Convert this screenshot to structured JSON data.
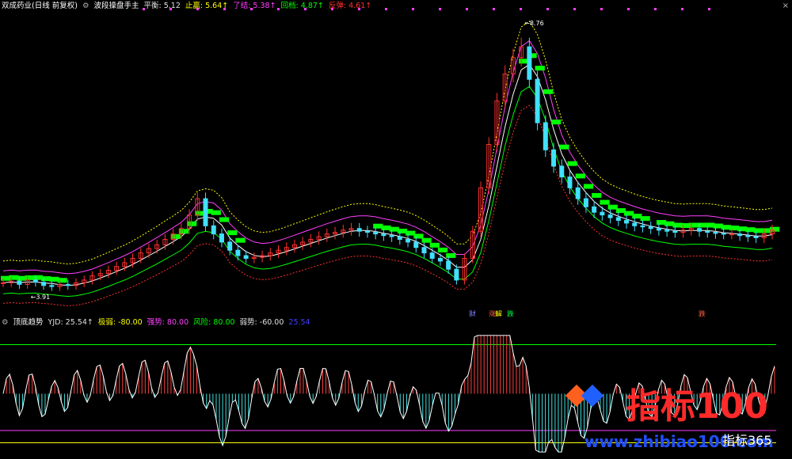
{
  "main_header": {
    "stock": "双成药业(日线 前复权)",
    "indicator": "波段操盘手主",
    "items": [
      {
        "label": "平衡:",
        "value": "5.12",
        "color": "#e0e0e0",
        "arrow": ""
      },
      {
        "label": "止赢:",
        "value": "5.64",
        "color": "#ffff00",
        "arrow": "↑"
      },
      {
        "label": "了结:",
        "value": "5.38",
        "color": "#ff40ff",
        "arrow": "↑"
      },
      {
        "label": "回档:",
        "value": "4.87",
        "color": "#00ff00",
        "arrow": "↑"
      },
      {
        "label": "反弹:",
        "value": "4.61",
        "color": "#ff3030",
        "arrow": "↑"
      }
    ]
  },
  "close_symbol": "×",
  "price_annotations": {
    "high": "8.76",
    "low": "3.91"
  },
  "signals": [
    {
      "text": "财",
      "color": "#8080ff"
    },
    {
      "text": "涨",
      "color": "#ff6040"
    },
    {
      "text": "解",
      "color": "#ffff00"
    },
    {
      "text": "跌",
      "color": "#00ff40"
    },
    {
      "text": "跌",
      "color": "#ff6040"
    }
  ],
  "sub_header": {
    "indicator": "顶底趋势",
    "items": [
      {
        "label": "YJD:",
        "value": "25.54",
        "color": "#e0e0e0",
        "arrow": "↑"
      },
      {
        "label": "极弱:",
        "value": "-80.00",
        "color": "#ffff00",
        "arrow": ""
      },
      {
        "label": "强势:",
        "value": "80.00",
        "color": "#ff40ff",
        "arrow": ""
      },
      {
        "label": "风险:",
        "value": "80.00",
        "color": "#00ff00",
        "arrow": ""
      },
      {
        "label": "弱势:",
        "value": "-60.00",
        "color": "#e0e0e0",
        "arrow": ""
      },
      {
        "label": "",
        "value": "25.54",
        "color": "#4040ff",
        "arrow": ""
      }
    ]
  },
  "watermark": {
    "brand": "指标100",
    "url": "www.zhibiao100.com",
    "corner": "指标365"
  },
  "chart_data": {
    "type": "candlestick",
    "price_range": [
      3.5,
      9.0
    ],
    "closes": [
      4.05,
      4.08,
      4.02,
      4.1,
      4.06,
      4.0,
      3.98,
      4.02,
      4.0,
      4.05,
      4.1,
      4.18,
      4.22,
      4.28,
      4.35,
      4.42,
      4.5,
      4.6,
      4.68,
      4.75,
      4.85,
      4.95,
      5.05,
      5.3,
      5.6,
      5.1,
      4.95,
      4.8,
      4.65,
      4.55,
      4.5,
      4.52,
      4.55,
      4.6,
      4.65,
      4.7,
      4.75,
      4.8,
      4.85,
      4.9,
      4.95,
      4.98,
      5.02,
      5.05,
      5.0,
      4.98,
      4.95,
      4.92,
      4.9,
      4.85,
      4.8,
      4.7,
      4.6,
      4.5,
      4.45,
      4.3,
      4.1,
      4.5,
      5.0,
      5.8,
      6.6,
      7.4,
      7.9,
      8.2,
      8.4,
      7.8,
      7.0,
      6.5,
      6.2,
      6.0,
      5.8,
      5.6,
      5.45,
      5.35,
      5.3,
      5.25,
      5.2,
      5.15,
      5.1,
      5.08,
      5.05,
      5.02,
      5.0,
      4.98,
      5.02,
      5.05,
      5.0,
      4.98,
      4.96,
      4.95,
      4.95,
      4.92,
      4.9,
      4.88,
      4.95,
      5.02
    ],
    "bands": [
      "止赢",
      "了结",
      "平衡",
      "回档",
      "反弹"
    ],
    "band_colors": [
      "#ffff00",
      "#ff40ff",
      "#ffffff",
      "#00ff00",
      "#ff3030"
    ],
    "oscillator": {
      "name": "YJD",
      "range": [
        -100,
        100
      ],
      "levels": [
        80,
        -60,
        -80
      ],
      "level_colors": [
        "#00ff00",
        "#ff40ff",
        "#ffff00"
      ],
      "last": 25.54
    }
  }
}
